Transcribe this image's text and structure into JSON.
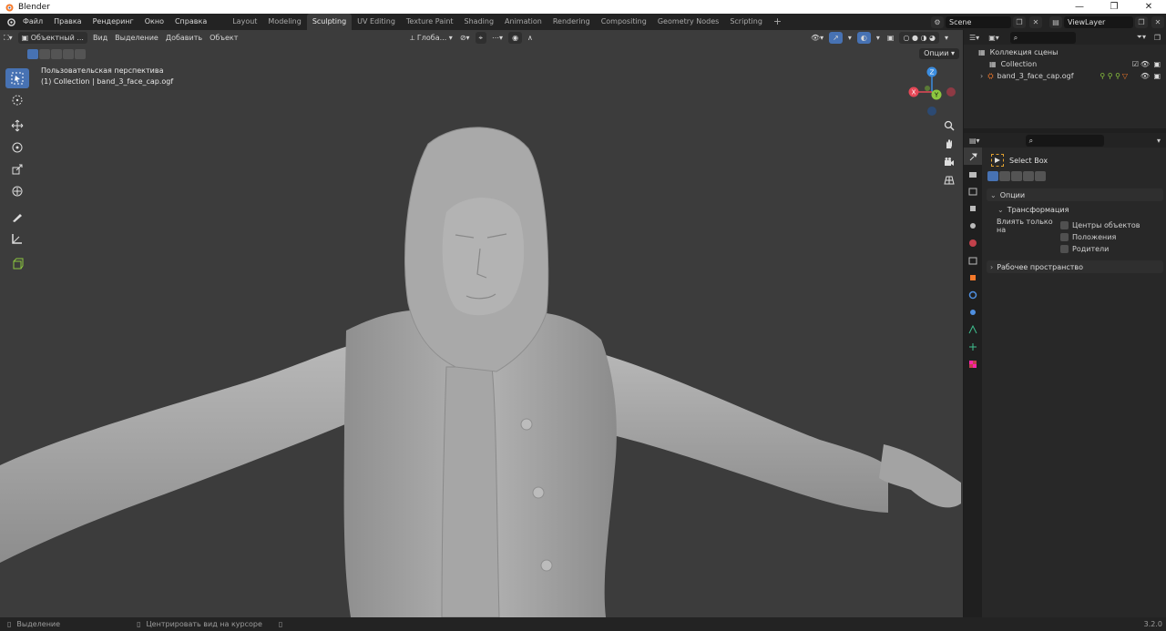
{
  "window": {
    "title": "Blender",
    "controls": [
      "—",
      "❐",
      "✕"
    ]
  },
  "menu": [
    "Файл",
    "Правка",
    "Рендеринг",
    "Окно",
    "Справка"
  ],
  "workspaces": [
    "Layout",
    "Modeling",
    "Sculpting",
    "UV Editing",
    "Texture Paint",
    "Shading",
    "Animation",
    "Rendering",
    "Compositing",
    "Geometry Nodes",
    "Scripting"
  ],
  "active_workspace": "Sculpting",
  "scene": "Scene",
  "view_layer": "ViewLayer",
  "viewport": {
    "mode": "Объектный ...",
    "menus": [
      "Вид",
      "Выделение",
      "Добавить",
      "Объект"
    ],
    "transform_orientation": "Глоба...",
    "options_label": "Опции",
    "perspective": "Пользовательская перспектива",
    "collection_info": "(1) Collection | band_3_face_cap.ogf",
    "gizmo_axes": {
      "z": "Z",
      "y": "Y",
      "x": "X"
    }
  },
  "outliner": {
    "root": "Коллекция сцены",
    "items": [
      "Collection",
      "band_3_face_cap.ogf"
    ]
  },
  "properties": {
    "tool_name": "Select Box",
    "options_header": "Опции",
    "transform_header": "Трансформация",
    "affect_only_label": "Влиять только на",
    "affect_options": [
      "Центры объектов",
      "Положения",
      "Родители"
    ],
    "workspace_header": "Рабочее пространство"
  },
  "status": {
    "left": "Выделение",
    "middle": "Центрировать вид на курсоре",
    "version": "3.2.0"
  },
  "colors": {
    "accent": "#4772b3",
    "axis_x": "#e54857",
    "axis_y": "#8cc63f",
    "axis_z": "#3b8de0",
    "model": "#a9a9a9"
  }
}
